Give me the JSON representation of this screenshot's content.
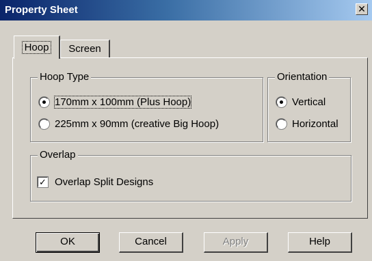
{
  "window": {
    "title": "Property Sheet",
    "close_symbol": "✕"
  },
  "tabs": [
    {
      "label": "Hoop",
      "active": true
    },
    {
      "label": "Screen",
      "active": false
    }
  ],
  "hoop_type": {
    "label": "Hoop Type",
    "options": [
      {
        "label": "170mm x 100mm (Plus Hoop)",
        "checked": true
      },
      {
        "label": "225mm x 90mm (creative Big Hoop)",
        "checked": false
      }
    ]
  },
  "orientation": {
    "label": "Orientation",
    "options": [
      {
        "label": "Vertical",
        "checked": true
      },
      {
        "label": "Horizontal",
        "checked": false
      }
    ]
  },
  "overlap": {
    "label": "Overlap",
    "checkbox_label": "Overlap Split Designs",
    "checked": true,
    "check_mark": "✓"
  },
  "buttons": {
    "ok": "OK",
    "cancel": "Cancel",
    "apply": "Apply",
    "help": "Help"
  }
}
